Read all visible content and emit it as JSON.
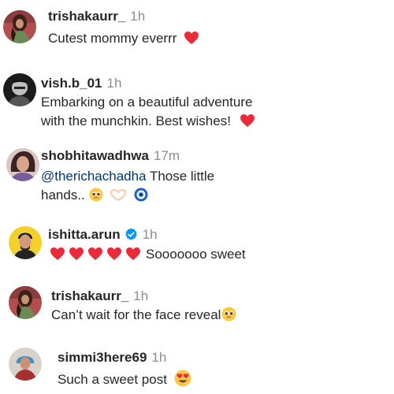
{
  "comments": [
    {
      "username": "trishakaurr_",
      "time": "1h",
      "text": "Cutest mommy everrr",
      "trailing_icons": [
        "red-heart"
      ],
      "avatar": "woman-with-long-dark-hair-green-dress"
    },
    {
      "username": "vish.b_01",
      "time": "1h",
      "text_lines": [
        "Embarking on a beautiful adventure",
        "with the munchkin. Best wishes!"
      ],
      "trailing_icons": [
        "red-heart"
      ],
      "avatar": "black-and-white-portrait"
    },
    {
      "username": "shobhitawadhwa",
      "time": "17m",
      "mention": "@therichachadha",
      "text_line1": "Those little",
      "text_line2": "hands..",
      "trailing_icons": [
        "pleading-face",
        "heart-hands",
        "nazar-amulet"
      ],
      "avatar": "woman-with-wavy-hair"
    },
    {
      "username": "ishitta.arun",
      "time": "1h",
      "verified": true,
      "hearts_count": 5,
      "text": "Sooooooo sweet",
      "leading_icons": [
        "red-heart"
      ],
      "avatar": "man-on-yellow-background"
    },
    {
      "username": "trishakaurr_",
      "time": "1h",
      "text": "Can’t wait for the face reveal",
      "trailing_icons": [
        "pleading-face"
      ],
      "avatar": "woman-with-long-dark-hair-green-dress"
    },
    {
      "username": "simmi3here69",
      "time": "1h",
      "text": "Such a sweet post",
      "trailing_icons": [
        "heart-eyes-face"
      ],
      "avatar": "person-with-blue-hair"
    }
  ],
  "colors": {
    "username": "#262626",
    "timestamp": "#8e8e8e",
    "mention": "#00376b",
    "heart": "#ed2a3a",
    "verified": "#0095f6"
  }
}
